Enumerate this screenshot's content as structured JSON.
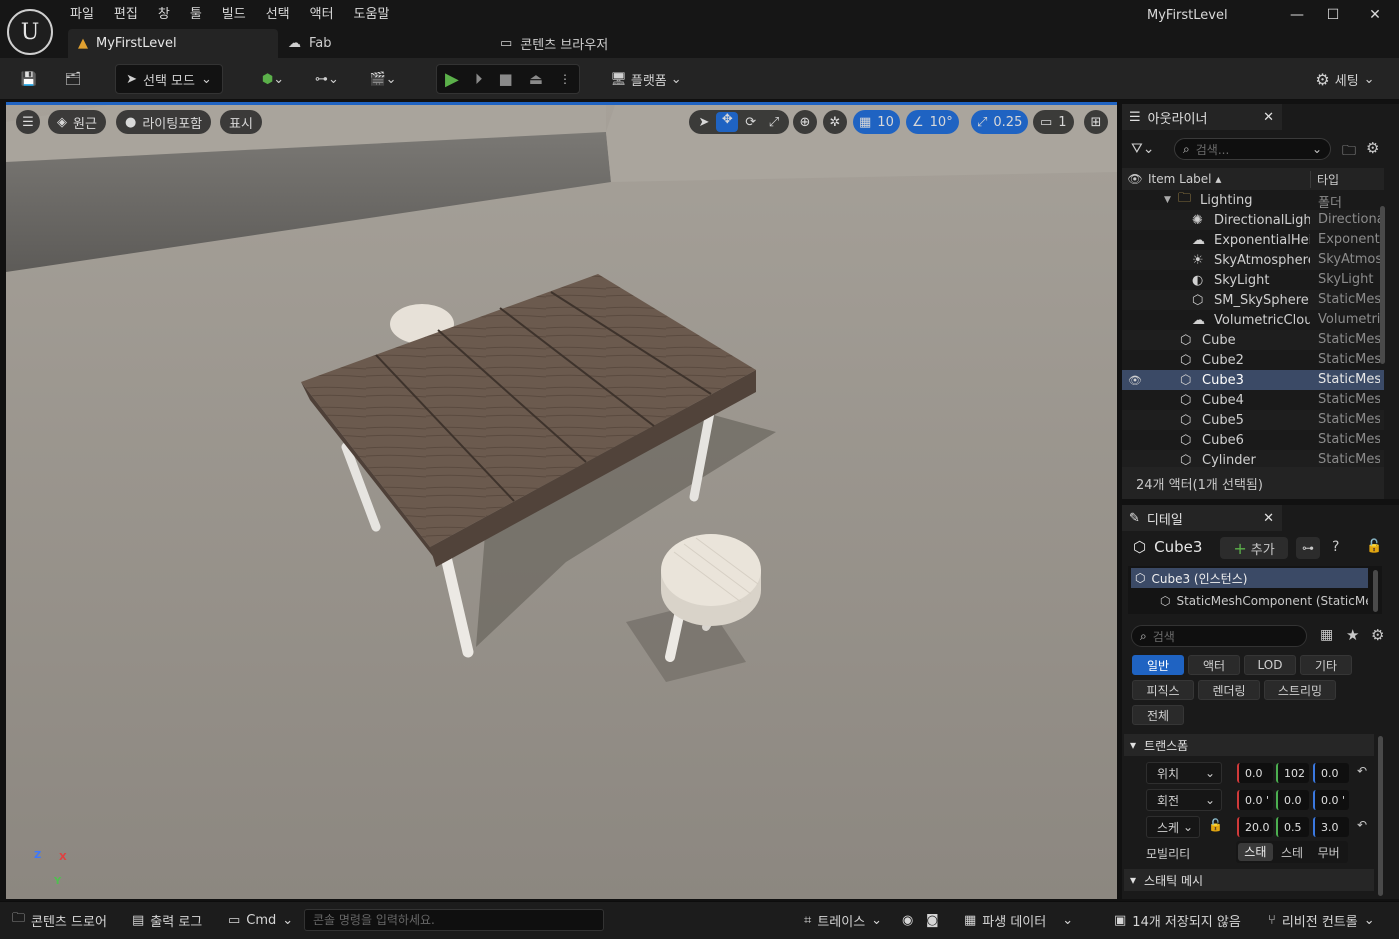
{
  "app": {
    "menu": [
      "파일",
      "편집",
      "창",
      "툴",
      "빌드",
      "선택",
      "액터",
      "도움말"
    ],
    "window_title": "MyFirstLevel",
    "tabs": [
      {
        "label": "MyFirstLevel"
      },
      {
        "label": "Fab"
      },
      {
        "label": "콘텐츠 브라우저"
      }
    ]
  },
  "toolbar": {
    "mode_label": "선택 모드",
    "platform_label": "플랫폼",
    "settings_label": "세팅"
  },
  "viewport": {
    "perspective_label": "원근",
    "lit_label": "라이팅포함",
    "show_label": "표시",
    "grid_snap": "10",
    "rotation_snap": "10°",
    "scale_snap": "0.25",
    "camera_speed": "1",
    "axis_x": "X",
    "axis_y": "Y",
    "axis_z": "Z"
  },
  "outliner": {
    "title": "아웃라이너",
    "search_placeholder": "검색...",
    "col_label": "Item Label",
    "col_type": "타입",
    "rows": [
      {
        "label": "Lighting",
        "type": "폴더",
        "icon": "folder-icon"
      },
      {
        "label": "DirectionalLight",
        "type": "Directiona",
        "icon": "sun-icon"
      },
      {
        "label": "ExponentialHeightFog",
        "type": "Exponenti",
        "icon": "fog-icon"
      },
      {
        "label": "SkyAtmosphere",
        "type": "SkyAtmos",
        "icon": "atmosphere-icon"
      },
      {
        "label": "SkyLight",
        "type": "SkyLight",
        "icon": "skylight-icon"
      },
      {
        "label": "SM_SkySphere",
        "type": "StaticMes",
        "icon": "mesh-icon"
      },
      {
        "label": "VolumetricCloud",
        "type": "Volumetric",
        "icon": "cloud-icon"
      },
      {
        "label": "Cube",
        "type": "StaticMes",
        "icon": "mesh-icon"
      },
      {
        "label": "Cube2",
        "type": "StaticMes",
        "icon": "mesh-icon"
      },
      {
        "label": "Cube3",
        "type": "StaticMes",
        "icon": "mesh-icon"
      },
      {
        "label": "Cube4",
        "type": "StaticMes",
        "icon": "mesh-icon"
      },
      {
        "label": "Cube5",
        "type": "StaticMes",
        "icon": "mesh-icon"
      },
      {
        "label": "Cube6",
        "type": "StaticMes",
        "icon": "mesh-icon"
      },
      {
        "label": "Cylinder",
        "type": "StaticMes",
        "icon": "mesh-icon"
      }
    ],
    "footer": "24개 액터(1개 선택됨)"
  },
  "details": {
    "title": "디테일",
    "actor_name": "Cube3",
    "add_label": "추가",
    "components": [
      "Cube3 (인스턴스)",
      "StaticMeshComponent (StaticMeshComponent)"
    ],
    "search_placeholder": "검색",
    "categories": [
      "일반",
      "액터",
      "LOD",
      "기타",
      "피직스",
      "렌더링",
      "스트리밍",
      "전체"
    ],
    "transform_section": "트랜스폼",
    "location_label": "위치",
    "rotation_label": "회전",
    "scale_label": "스케일",
    "location": [
      "0.0",
      "102",
      "0.0"
    ],
    "rotation": [
      "0.0 '",
      "0.0",
      "0.0 '"
    ],
    "scale": [
      "20.0",
      "0.5",
      "3.0"
    ],
    "mobility_label": "모빌리티",
    "mobility_options": [
      "스태",
      "스테",
      "무버"
    ],
    "static_mesh_section": "스태틱 메시"
  },
  "statusbar": {
    "content_drawer": "콘텐츠 드로어",
    "output_log": "출력 로그",
    "cmd": "Cmd",
    "console_placeholder": "콘솔 명령을 입력하세요.",
    "trace": "트레이스",
    "derived_data": "파생 데이터",
    "unsaved": "14개 저장되지 않음",
    "revision_control": "리비전 컨트롤"
  },
  "colors": {
    "accent": "#1f63c2",
    "selection": "#3b4a66",
    "play_green": "#5bb04a"
  }
}
